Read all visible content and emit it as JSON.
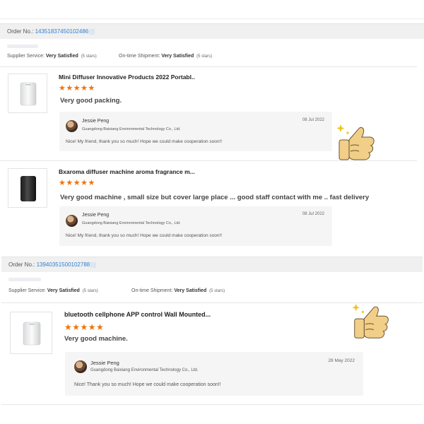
{
  "orders": [
    {
      "order_label": "Order No.:",
      "order_number": "14351837450102486",
      "supplier_label": "Supplier Service:",
      "supplier_value": "Very Satisfied",
      "supplier_note": "(5 stars)",
      "shipment_label": "On-time Shipment:",
      "shipment_value": "Very Satisfied",
      "shipment_note": "(5 stars)",
      "items": [
        {
          "title": "Mini Diffuser Innovative Products 2022 Portabl..",
          "stars": "★★★★★",
          "review": "Very good packing.",
          "reply": {
            "name": "Jessie Peng",
            "company": "Guangdong Baixiang Environmental Technology Co., Ltd.",
            "date": "08 Jul 2022",
            "message": "Nice! My friend, thank you so much! Hope we could make cooperation soon!!"
          }
        },
        {
          "title": "Bxaroma diffuser machine aroma fragrance m...",
          "stars": "★★★★★",
          "review": "Very good machine , small size but cover large place ... good staff contact with me .. fast delivery",
          "reply": {
            "name": "Jessie Peng",
            "company": "Guangdong Baixiang Environmental Technology Co., Ltd.",
            "date": "08 Jul 2022",
            "message": "Nice! My friend, thank you so much! Hope we could make cooperation soon!!"
          }
        }
      ]
    },
    {
      "order_label": "Order No.:",
      "order_number": "13940351500102788",
      "supplier_label": "Supplier Service:",
      "supplier_value": "Very Satisfied",
      "supplier_note": "(5 stars)",
      "shipment_label": "On-time Shipment:",
      "shipment_value": "Very Satisfied",
      "shipment_note": "(5 stars)",
      "items": [
        {
          "title": "bluetooth cellphone APP control Wall Mounted...",
          "stars": "★★★★★",
          "review": "Very good machine.",
          "reply": {
            "name": "Jessie Peng",
            "company": "Guangdong Baixiang Environmental Technology Co., Ltd.",
            "date": "28 May 2022",
            "message": "Nice! Thank you so much! Hope we could make cooperation soon!!"
          }
        }
      ]
    }
  ],
  "icons": {
    "thumbs_up": "thumbs-up-icon",
    "avatar": "avatar",
    "star": "star-icon"
  },
  "colors": {
    "star": "#f0720b",
    "order_link": "#2f7fd1",
    "bar_bg": "#f0f0f0",
    "reply_bg": "#f5f5f5"
  }
}
